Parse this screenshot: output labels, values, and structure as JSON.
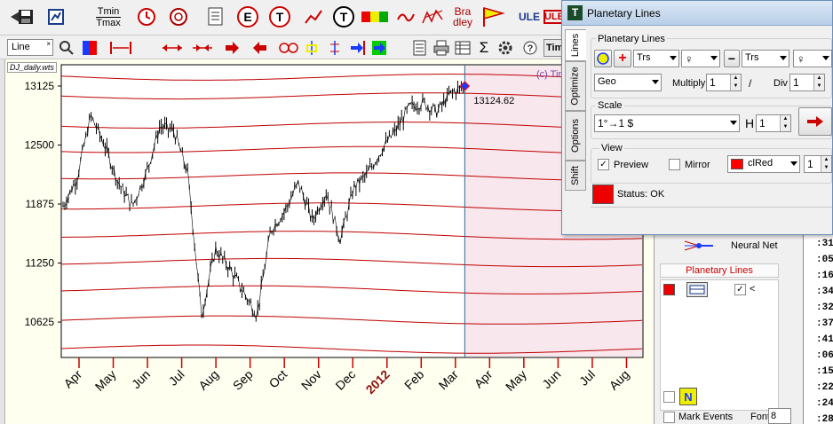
{
  "toolbar": {
    "tmin_label": "Tmin",
    "tmax_label": "Tmax",
    "bradley_line1": "Bra",
    "bradley_line2": "dley",
    "ule_label": "ULE",
    "ule2_label": "ULE",
    "tim_label": "Tim"
  },
  "toolbar2": {
    "line_combo": "Line",
    "sigma_glyph": "Σ"
  },
  "chart": {
    "file_label": "DJ_daily.wts",
    "copyright": "(c) Tim",
    "price_readout": "13124.62",
    "y_ticks": [
      "13125",
      "12500",
      "11875",
      "11250",
      "10625"
    ],
    "x_ticks": [
      "Apr",
      "May",
      "Jun",
      "Jul",
      "Aug",
      "Sep",
      "Oct",
      "Nov",
      "Dec",
      "2012",
      "Feb",
      "Mar",
      "Apr",
      "May",
      "Jun",
      "Jul",
      "Aug"
    ]
  },
  "chart_data": {
    "type": "line",
    "title": "",
    "ylim": [
      10250,
      13350
    ],
    "y_ticks": [
      13125,
      12500,
      11875,
      11250,
      10625
    ],
    "x": [
      "Apr",
      "May",
      "Jun",
      "Jul",
      "Aug",
      "Sep",
      "Oct",
      "Nov",
      "Dec",
      "2012",
      "Feb",
      "Mar",
      "Apr",
      "May",
      "Jun",
      "Jul",
      "Aug"
    ],
    "series": [
      {
        "values": [
          11850,
          12150,
          12810,
          12500,
          12100,
          11850,
          12200,
          12700,
          12650,
          12200,
          10700,
          11400,
          11200,
          10950,
          10700,
          11600,
          11800,
          12100,
          11700,
          12000,
          11500,
          12050,
          12200,
          12450,
          12650,
          12900,
          12950,
          12850,
          13050,
          13124.62
        ]
      }
    ],
    "planetary_lines_y": [
      13230,
      13030,
      12720,
      12460,
      12180,
      11860,
      11560,
      11270,
      10980,
      10660,
      10350
    ],
    "selection_divider": "Apr",
    "colors": {
      "price": "#000000",
      "planetary_lines": "#c00000",
      "future_zone": "#f8e8ee",
      "background": "#fffff0"
    }
  },
  "dialog": {
    "title": "Planetary Lines",
    "tabs": [
      "Lines",
      "Optimize",
      "Options",
      "Shift"
    ],
    "planetary_group_label": "Planetary Lines",
    "planet1": "Trs",
    "planet2": "Trs",
    "coord": "Geo",
    "multiply_label": "Multiply",
    "multiply_value": "1",
    "slash": "/",
    "div_label": "Div",
    "div_value": "1",
    "scale_group_label": "Scale",
    "scale_value": "1°→1 $",
    "h_label": "H",
    "h_value": "1",
    "view_group_label": "View",
    "preview_label": "Preview",
    "mirror_label": "Mirror",
    "color_value": "clRed",
    "width_value": "1",
    "status_text": "Status: OK"
  },
  "right_panel": {
    "neural_net_label": "Neural Net",
    "planetary_lines_header": "Planetary Lines",
    "item_symbol": "<",
    "mark_events_label": "Mark Events",
    "font_label": "Font",
    "font_value": "8"
  },
  "time_list": [
    ":31",
    ":05",
    ":16",
    ":34",
    ":32",
    ":37",
    ":41",
    ":06",
    ":15",
    ":22",
    ":24",
    ":28"
  ]
}
